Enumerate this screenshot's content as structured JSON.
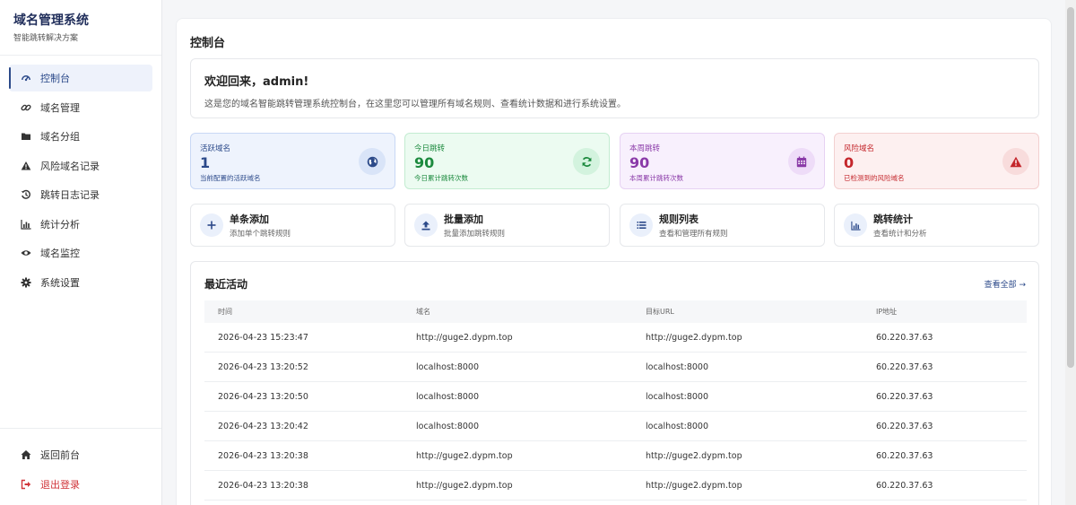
{
  "brand": {
    "title": "域名管理系统",
    "subtitle": "智能跳转解决方案"
  },
  "sidebar": {
    "items": [
      {
        "label": "控制台",
        "icon": "dashboard-icon",
        "active": true
      },
      {
        "label": "域名管理",
        "icon": "link-icon"
      },
      {
        "label": "域名分组",
        "icon": "folder-icon"
      },
      {
        "label": "风险域名记录",
        "icon": "warning-icon"
      },
      {
        "label": "跳转日志记录",
        "icon": "history-icon"
      },
      {
        "label": "统计分析",
        "icon": "bar-chart-icon"
      },
      {
        "label": "域名监控",
        "icon": "eye-icon"
      },
      {
        "label": "系统设置",
        "icon": "gear-icon"
      }
    ],
    "bottom": [
      {
        "label": "返回前台",
        "icon": "home-icon"
      },
      {
        "label": "退出登录",
        "icon": "logout-icon"
      }
    ]
  },
  "main": {
    "title": "控制台",
    "welcome": {
      "title": "欢迎回来，admin!",
      "text": "这是您的域名智能跳转管理系统控制台，在这里您可以管理所有域名规则、查看统计数据和进行系统设置。"
    },
    "stats": [
      {
        "label": "活跃域名",
        "value": "1",
        "desc": "当前配置的活跃域名",
        "icon": "globe-icon",
        "color": "#2c4a8a",
        "bg": "#eef3fd",
        "border": "#c9d8f5",
        "icon_bg": "#d9e4f8"
      },
      {
        "label": "今日跳转",
        "value": "90",
        "desc": "今日累计跳转次数",
        "icon": "refresh-icon",
        "color": "#1c8a3e",
        "bg": "#ecfbf1",
        "border": "#c3ecd1",
        "icon_bg": "#d3f3de"
      },
      {
        "label": "本周跳转",
        "value": "90",
        "desc": "本周累计跳转次数",
        "icon": "calendar-icon",
        "color": "#8a3aa8",
        "bg": "#f8f0fd",
        "border": "#e7d2f3",
        "icon_bg": "#eedcf8"
      },
      {
        "label": "风险域名",
        "value": "0",
        "desc": "已检测到的风险域名",
        "icon": "alert-triangle-icon",
        "color": "#c4262b",
        "bg": "#fdf0f0",
        "border": "#f3d0d0",
        "icon_bg": "#f8dcdc"
      }
    ],
    "quick_actions": [
      {
        "title": "单条添加",
        "desc": "添加单个跳转规则",
        "icon": "plus-icon"
      },
      {
        "title": "批量添加",
        "desc": "批量添加跳转规则",
        "icon": "upload-icon"
      },
      {
        "title": "规则列表",
        "desc": "查看和管理所有规则",
        "icon": "list-icon"
      },
      {
        "title": "跳转统计",
        "desc": "查看统计和分析",
        "icon": "bar-chart-icon"
      }
    ],
    "activity": {
      "title": "最近活动",
      "view_all": "查看全部 →",
      "columns": [
        "时间",
        "域名",
        "目标URL",
        "IP地址"
      ],
      "rows": [
        [
          "2026-04-23 15:23:47",
          "http://guge2.dypm.top",
          "http://guge2.dypm.top",
          "60.220.37.63"
        ],
        [
          "2026-04-23 13:20:52",
          "localhost:8000",
          "localhost:8000",
          "60.220.37.63"
        ],
        [
          "2026-04-23 13:20:50",
          "localhost:8000",
          "localhost:8000",
          "60.220.37.63"
        ],
        [
          "2026-04-23 13:20:42",
          "localhost:8000",
          "localhost:8000",
          "60.220.37.63"
        ],
        [
          "2026-04-23 13:20:38",
          "http://guge2.dypm.top",
          "http://guge2.dypm.top",
          "60.220.37.63"
        ],
        [
          "2026-04-23 13:20:38",
          "http://guge2.dypm.top",
          "http://guge2.dypm.top",
          "60.220.37.63"
        ]
      ]
    }
  }
}
